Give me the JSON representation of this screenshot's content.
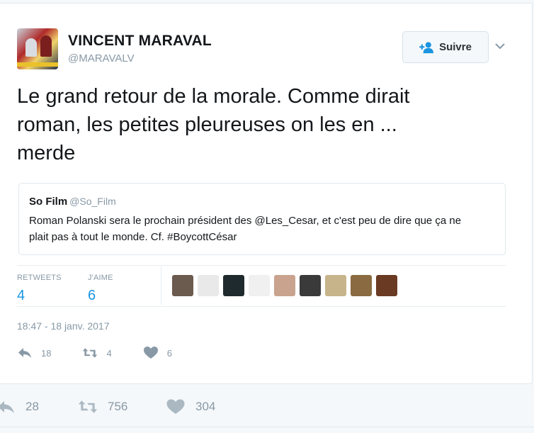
{
  "author": {
    "name": "VINCENT MARAVAL",
    "handle": "@MARAVALV"
  },
  "follow_button": {
    "label": "Suivre",
    "icon": "follow-person-plus-icon"
  },
  "tweet": {
    "text": "Le grand retour de la morale. Comme dirait\nroman, les petites pleureuses on les  en ...\nmerde"
  },
  "quoted_tweet": {
    "name": "So Film",
    "handle": "@So_Film",
    "text": "Roman Polanski sera le prochain président des @Les_Cesar, et c'est peu de dire que ça ne plait pas à tout le monde. Cf. #BoycottCésar"
  },
  "stats": {
    "retweets_label": "RETWEETS",
    "retweets_value": "4",
    "likes_label": "J'AIME",
    "likes_value": "6"
  },
  "likers": [
    {
      "name": "liker-avatar-1",
      "color": "#6b5a4e"
    },
    {
      "name": "liker-avatar-2",
      "color": "#e9e9e9"
    },
    {
      "name": "liker-avatar-3",
      "color": "#1f2a2e"
    },
    {
      "name": "liker-avatar-4",
      "color": "#f0f0f0"
    },
    {
      "name": "liker-avatar-5",
      "color": "#c9a38e"
    },
    {
      "name": "liker-avatar-6",
      "color": "#3a3a3a"
    },
    {
      "name": "liker-avatar-7",
      "color": "#c8b48a"
    },
    {
      "name": "liker-avatar-8",
      "color": "#8a6a40"
    },
    {
      "name": "liker-avatar-9",
      "color": "#6a3a22"
    }
  ],
  "timestamp": "18:47 - 18 janv. 2017",
  "inner_actions": {
    "reply_count": "18",
    "retweet_count": "4",
    "like_count": "6"
  },
  "outer_actions": {
    "reply_count": "28",
    "retweet_count": "756",
    "like_count": "304"
  },
  "colors": {
    "accent": "#1b95e0",
    "muted": "#8899a6"
  }
}
